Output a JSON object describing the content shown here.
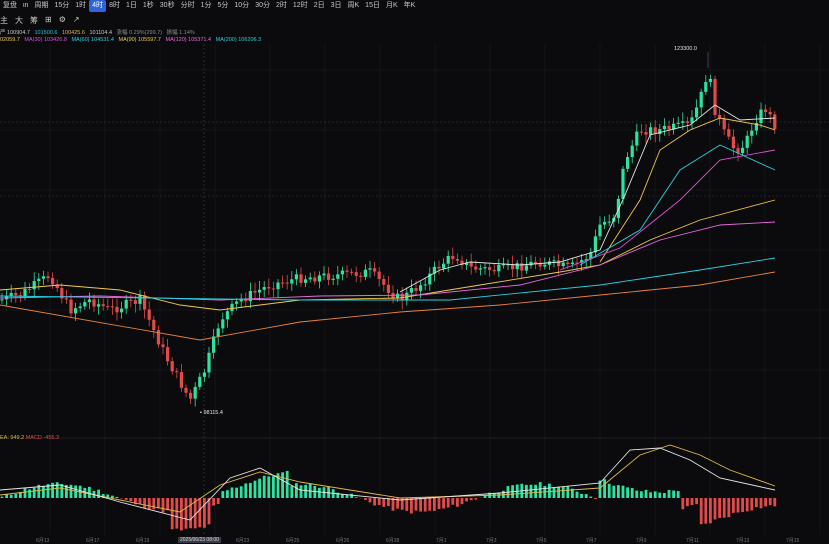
{
  "toolbar": {
    "items": [
      "复盘",
      "ιn",
      "周期",
      "15分",
      "1时",
      "4时",
      "8时",
      "1日",
      "1秒",
      "30秒",
      "分时",
      "1分",
      "5分",
      "10分",
      "30分",
      "2时",
      "12时",
      "2日",
      "3日",
      "周K",
      "15日",
      "月K",
      "年K"
    ],
    "active_index": 5
  },
  "indicators_row": [
    "主",
    "大",
    "筹",
    "⊞",
    "⚙",
    "↗"
  ],
  "legend_boll": {
    "items": [
      {
        "text": "严 100904.7",
        "color": "#c9c9c9"
      },
      {
        "text": "101500.6",
        "color": "#26c6da"
      },
      {
        "text": "100425.6",
        "color": "#e0b84a"
      },
      {
        "text": "101104.4",
        "color": "#c9c9c9"
      },
      {
        "text": "涨幅 0.29%(299.7)",
        "color": "#8a8a8a"
      },
      {
        "text": "振幅 1.14%",
        "color": "#8a8a8a"
      }
    ]
  },
  "legend_ma": {
    "items": [
      {
        "text": "02059.7",
        "color": "#f2c94c"
      },
      {
        "text": "MA(30) 103426.8",
        "color": "#d94fd4"
      },
      {
        "text": "MA(60) 104531.4",
        "color": "#2ad0e0"
      },
      {
        "text": "MA(90) 105597.7",
        "color": "#f2c94c"
      },
      {
        "text": "MA(120) 105371.4",
        "color": "#e76ae0"
      },
      {
        "text": "MA(200) 106206.3",
        "color": "#2ad0e0"
      }
    ]
  },
  "macd_legend": {
    "items": [
      {
        "text": "EA: 949.2",
        "color": "#e0b84a"
      },
      {
        "text": "MACD -455.3",
        "color": "#e24b4b"
      }
    ]
  },
  "high_label": "123300.0",
  "low_label": "98115.4",
  "colors": {
    "up": "#2ee3a0",
    "down": "#e24b4b",
    "bg": "#0b0b0d",
    "grid": "#1a1a1f"
  },
  "date_labels": [
    "6月13",
    "6月17",
    "6月19",
    "6月21",
    "6月23",
    "6月25",
    "6月26",
    "6月28",
    "7月1",
    "7月3",
    "7月5",
    "7月7",
    "7月9",
    "7月11",
    "7月13",
    "7月15",
    "7月17",
    "7月19"
  ],
  "crosshair_date": "2025/06/23 08:00"
}
